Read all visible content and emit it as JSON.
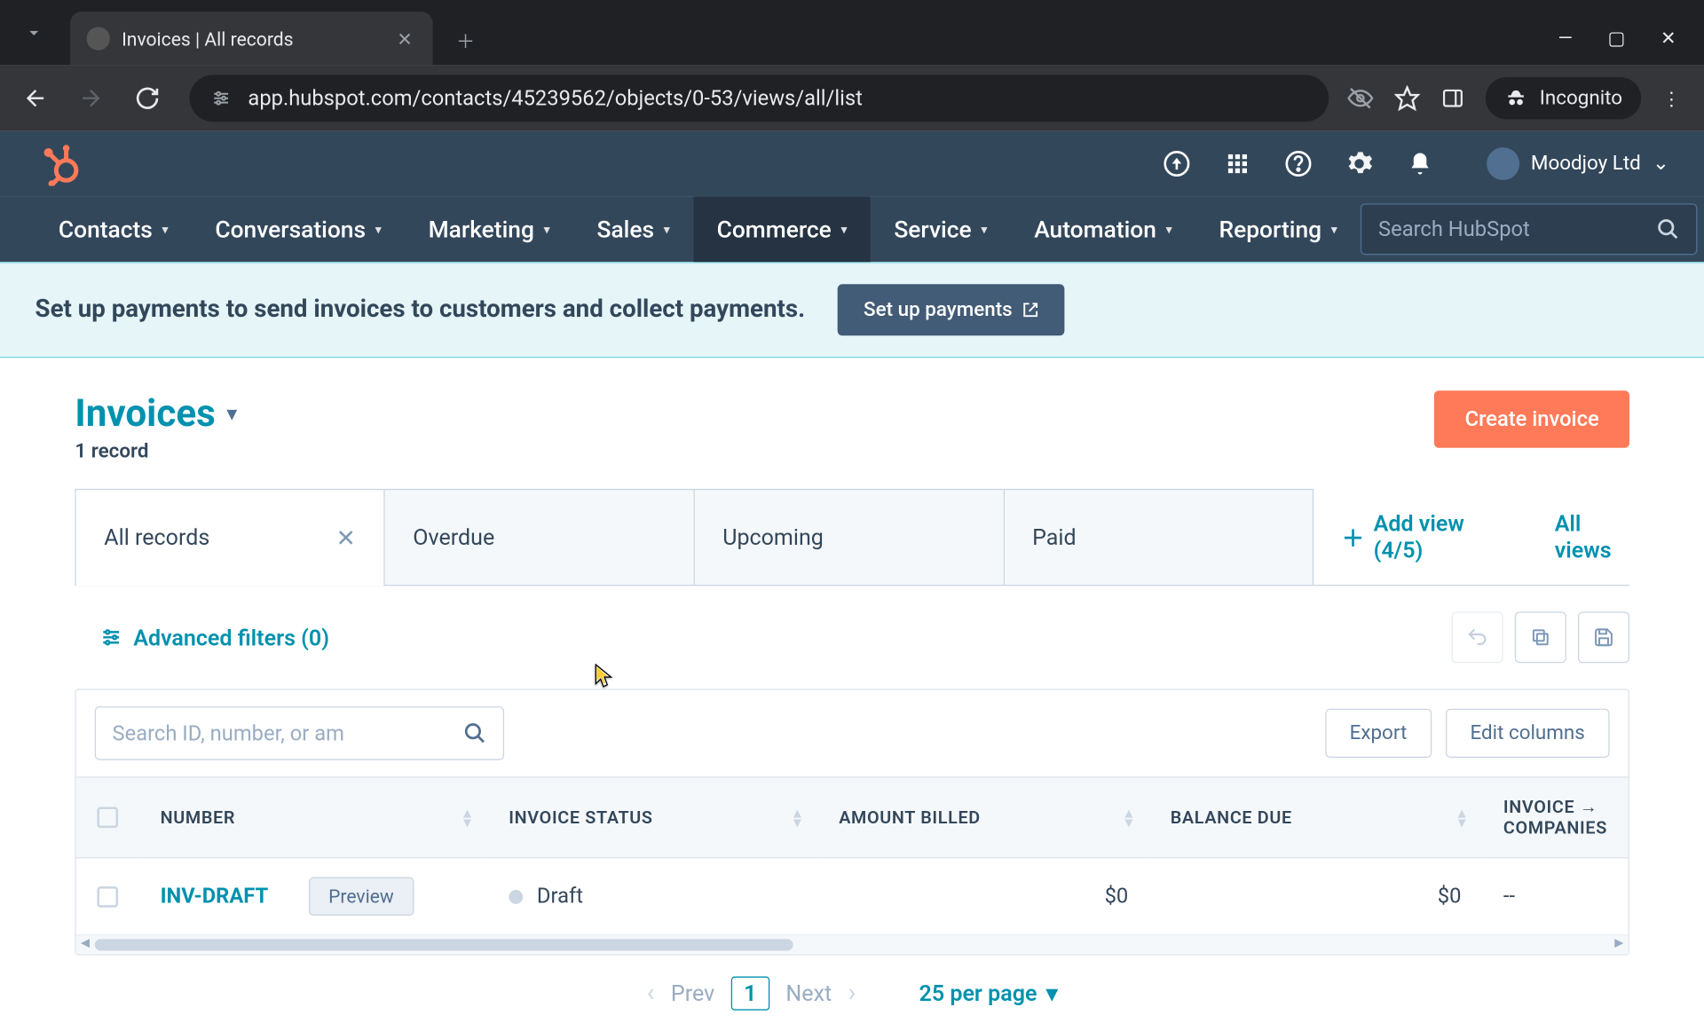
{
  "browser": {
    "tab_title": "Invoices | All records",
    "url": "app.hubspot.com/contacts/45239562/objects/0-53/views/all/list",
    "incognito_label": "Incognito"
  },
  "header": {
    "account_name": "Moodjoy Ltd"
  },
  "nav": {
    "items": [
      "Contacts",
      "Conversations",
      "Marketing",
      "Sales",
      "Commerce",
      "Service",
      "Automation",
      "Reporting"
    ],
    "active": "Commerce",
    "search_placeholder": "Search HubSpot"
  },
  "banner": {
    "text": "Set up payments to send invoices to customers and collect payments.",
    "button": "Set up payments"
  },
  "page": {
    "title": "Invoices",
    "record_count": "1 record",
    "create_button": "Create invoice"
  },
  "tabs": {
    "items": [
      "All records",
      "Overdue",
      "Upcoming",
      "Paid"
    ],
    "active_index": 0,
    "add_view": "Add view (4/5)",
    "all_views": "All views"
  },
  "filters": {
    "advanced": "Advanced filters (0)"
  },
  "table": {
    "search_placeholder": "Search ID, number, or am",
    "export": "Export",
    "edit_columns": "Edit columns",
    "columns": [
      "NUMBER",
      "INVOICE STATUS",
      "AMOUNT BILLED",
      "BALANCE DUE",
      "INVOICE → COMPANIES"
    ],
    "rows": [
      {
        "number": "INV-DRAFT",
        "preview": "Preview",
        "status": "Draft",
        "amount": "$0",
        "balance": "$0",
        "companies": "--"
      }
    ]
  },
  "pagination": {
    "prev": "Prev",
    "page": "1",
    "next": "Next",
    "per_page": "25 per page"
  }
}
